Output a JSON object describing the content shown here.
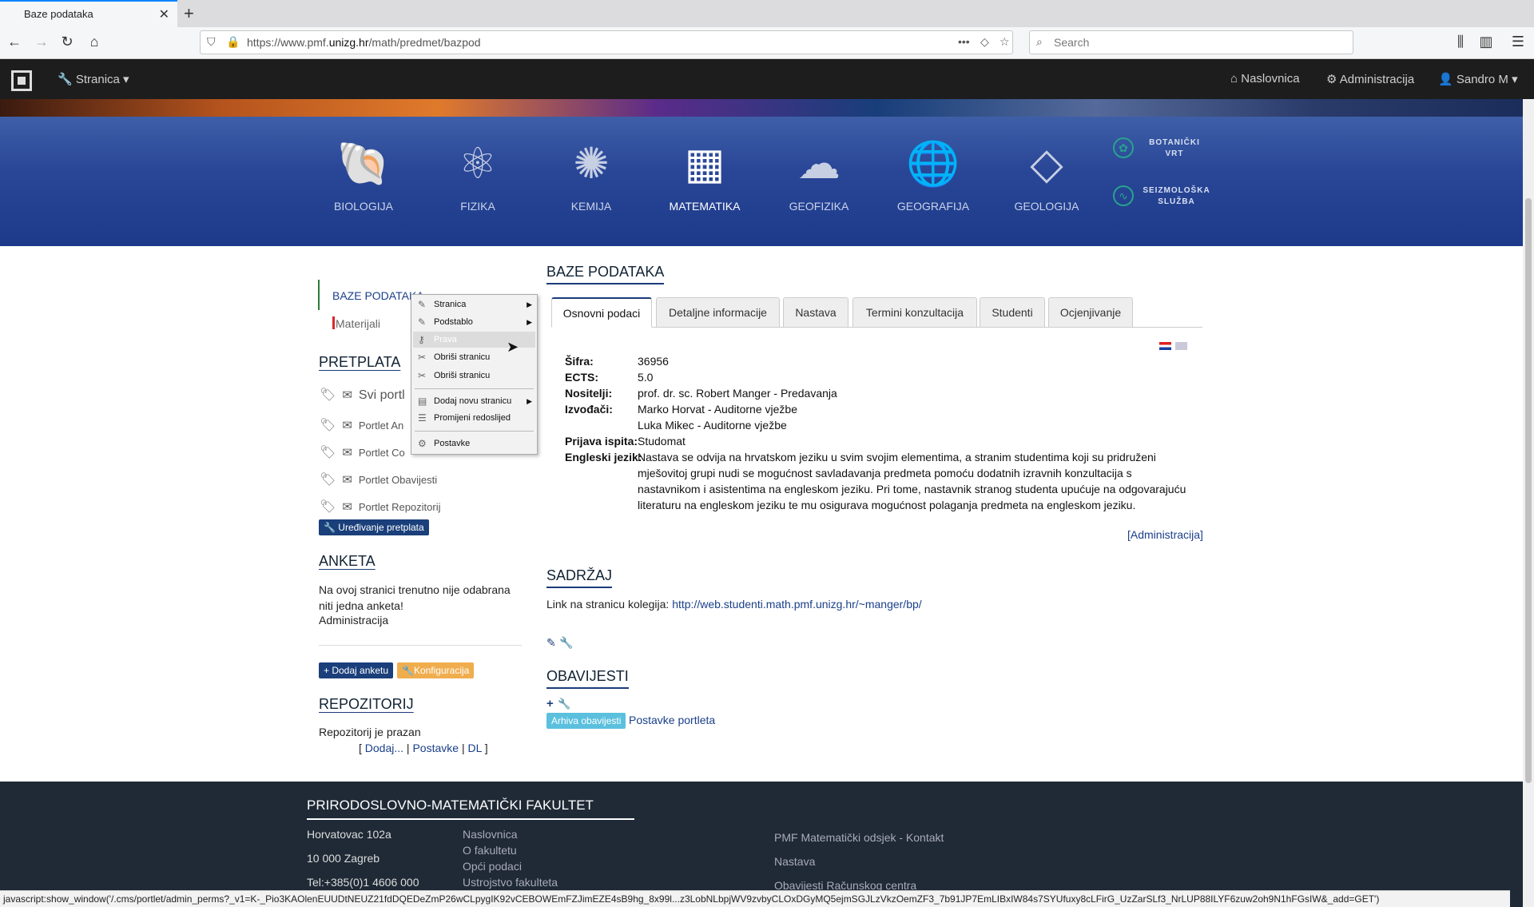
{
  "browser": {
    "tab_title": "Baze podataka",
    "tab_close": "✕",
    "new_tab": "+",
    "url_prefix": "https://www.pmf.",
    "url_domain": "unizg.hr",
    "url_path": "/math/predmet/bazpod",
    "url_more": "•••",
    "search_placeholder": "Search"
  },
  "topbar": {
    "page_menu": "Stranica",
    "home": "Naslovnica",
    "admin": "Administracija",
    "user": "Sandro M"
  },
  "departments": [
    {
      "label": "BIOLOGIJA",
      "icon": "biology-shell-icon"
    },
    {
      "label": "FIZIKA",
      "icon": "atom-icon"
    },
    {
      "label": "KEMIJA",
      "icon": "molecule-icon"
    },
    {
      "label": "MATEMATIKA",
      "icon": "grid-shape-icon"
    },
    {
      "label": "GEOFIZIKA",
      "icon": "cloud-rain-icon"
    },
    {
      "label": "GEOGRAFIJA",
      "icon": "globe-pin-icon"
    },
    {
      "label": "GEOLOGIJA",
      "icon": "diamond-icon"
    }
  ],
  "side_links": {
    "garden_line1": "BOTANIČKI",
    "garden_line2": "VRT",
    "seismo_line1": "SEIZMOLOŠKA",
    "seismo_line2": "SLUŽBA"
  },
  "sidebar": {
    "nav_active": "BAZE PODATAKA",
    "nav_sub": "Materijali",
    "subscriptions_title": "PRETPLATA",
    "subscriptions": [
      "Svi portl",
      "Portlet An",
      "Portlet Co",
      "Portlet Obavijesti",
      "Portlet Repozitorij"
    ],
    "edit_subscriptions": "Uređivanje pretplata",
    "poll_title": "ANKETA",
    "poll_text": "Na ovoj stranici trenutno nije odabrana niti jedna anketa!",
    "poll_admin": "Administracija",
    "add_poll": "Dodaj anketu",
    "configuration": "Konfiguracija",
    "repo_title": "REPOZITORIJ",
    "repo_empty": "Repozitorij je prazan",
    "repo_open": "[",
    "repo_add": "Dodaj...",
    "repo_sep1": "|",
    "repo_settings": "Postavke",
    "repo_sep2": "|",
    "repo_dl": "DL",
    "repo_close": "]"
  },
  "context_menu": {
    "items": [
      {
        "label": "Stranica",
        "submenu": true
      },
      {
        "label": "Podstablo",
        "submenu": true
      },
      {
        "label": "Prava",
        "submenu": false
      },
      {
        "label": "Obriši stranicu",
        "submenu": false
      },
      {
        "label": "Obriši stranicu",
        "submenu": false
      },
      {
        "label": "Dodaj novu stranicu",
        "submenu": true
      },
      {
        "label": "Promijeni redoslijed",
        "submenu": false
      },
      {
        "label": "Postavke",
        "submenu": false
      }
    ]
  },
  "main": {
    "title": "BAZE PODATAKA",
    "tabs": [
      "Osnovni podaci",
      "Detaljne informacije",
      "Nastava",
      "Termini konzultacija",
      "Studenti",
      "Ocjenjivanje"
    ],
    "info": {
      "code_label": "Šifra:",
      "code": "36956",
      "ects_label": "ECTS:",
      "ects": "5.0",
      "holders_label": "Nositelji:",
      "holders": "prof. dr. sc. Robert Manger - Predavanja",
      "performers_label": "Izvođači:",
      "performer1": "Marko Horvat - Auditorne vježbe",
      "performer2": "Luka Mikec - Auditorne vježbe",
      "exam_label": "Prijava ispita:",
      "exam": "Studomat",
      "english_label": "Engleski jezik:",
      "english_line1": "Nastava se odvija na hrvatskom jeziku u svim svojim elementima, a stranim studentima koji su pridruženi",
      "english_line2": "mješovitoj grupi nudi se mogućnost savladavanja predmeta pomoću dodatnih izravnih konzultacija s",
      "english_line3": "nastavnikom i asistentima na engleskom jeziku. Pri tome, nastavnik stranog studenta upućuje na odgovarajuću",
      "english_line4": "literaturu na engleskom jeziku te mu osigurava mogućnost polaganja predmeta na engleskom jeziku."
    },
    "admin_link": "[Administracija]",
    "content_title": "SADRŽAJ",
    "content_text": "Link na stranicu kolegija: ",
    "content_link": "http://web.studenti.math.pmf.unizg.hr/~manger/bp/",
    "news_title": "OBAVIJESTI",
    "news_archive": "Arhiva obavijesti",
    "news_settings": "Postavke portleta"
  },
  "footer": {
    "title": "PRIRODOSLOVNO-MATEMATIČKI FAKULTET",
    "address1": "Horvatovac 102a",
    "address2": "10 000 Zagreb",
    "phone": "Tel:+385(0)1 4606 000",
    "links": [
      "Naslovnica",
      "O fakultetu",
      "Opći podaci",
      "Ustrojstvo fakulteta"
    ],
    "right_links": [
      "PMF Matematički odsjek - Kontakt",
      "Nastava",
      "Obavijesti Računskog centra"
    ]
  },
  "status_bar": "javascript:show_window('/.cms/portlet/admin_perms?_v1=K-_Pio3KAOlenEUUDtNEUZ21fdDQEDeZmP26wCLpygIK92vCEBOWEmFZJimEZE4sB9hg_8x99l...z3LobNLbpjWV9zvbyCLOxDGyMQ5ejmSGJLzVkzOemZF3_7b91JP7EmLIBxIW84s7SYUfuxy8cLFirG_UzZarSLf3_NrLUP88ILYF6zuw2oh9N1hFGsIW&_add=GET')",
  "colors": {
    "accent": "#1a3f7a",
    "banner": "#2a4797",
    "orange": "#f0ad4e",
    "footer": "#1f2a36"
  }
}
